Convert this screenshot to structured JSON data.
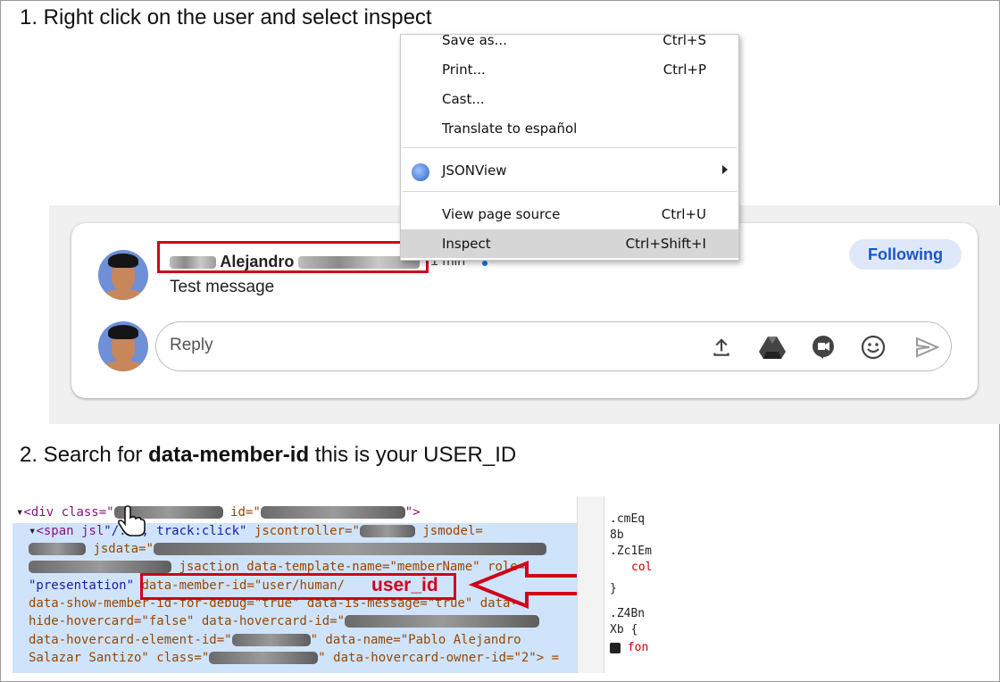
{
  "steps": {
    "step1": "1. Right click on the user and select inspect",
    "step2_prefix": "2. Search for ",
    "step2_bold": "data-member-id",
    "step2_suffix": " this is your USER_ID"
  },
  "context_menu": {
    "items": [
      {
        "label": "Save as...",
        "shortcut": "Ctrl+S"
      },
      {
        "label": "Print...",
        "shortcut": "Ctrl+P"
      },
      {
        "label": "Cast...",
        "shortcut": ""
      },
      {
        "label": "Translate to español",
        "shortcut": ""
      },
      {
        "label": "JSONView",
        "shortcut": ""
      },
      {
        "label": "View page source",
        "shortcut": "Ctrl+U"
      },
      {
        "label": "Inspect",
        "shortcut": "Ctrl+Shift+I"
      }
    ]
  },
  "chat": {
    "sender_name": "Alejandro",
    "time": "1 min",
    "message": "Test message",
    "following_label": "Following",
    "reply_placeholder": "Reply"
  },
  "devtools": {
    "line1_open": "<div class=\"",
    "line1_id": "id=\"",
    "line1_close": "\">",
    "line2_span": "<span jsl",
    "line2_track": "\"/..., track:click\"",
    "line2_jscontroller": "jscontroller=\"",
    "line2_jsmodel": "jsmodel=",
    "line3_jsdata": "jsdata=\"",
    "line4_jsaction": "jsaction data-template-name=\"memberName\" role=",
    "line5_presentation": "\"presentation\"",
    "line5_member": "data-member-id=\"user/human/",
    "user_id_label": "user_id",
    "line6": "data-show-member-id-for-debug=\"true\" data-is-message=\"true\" data-",
    "line7_a": "hide-hovercard=\"false\" data-hovercard-id=\"",
    "line8_a": "data-hovercard-element-id=\"",
    "line8_b": "\" data-name=\"Pablo Alejandro",
    "line9_a": "Salazar Santizo\" class=\"",
    "line9_b": "\" data-hovercard-owner-id=\"2\"> ="
  },
  "devtools_right": {
    "lines": [
      ".cmEq",
      "8b",
      ".Zc1Em",
      "col",
      "}",
      ".Z4Bn",
      "Xb {",
      "fon"
    ]
  },
  "colors": {
    "highlight_red": "#d0021b",
    "following_bg": "#dfe8f8",
    "following_text": "#1a56c8",
    "selection_blue": "#cfe4fb"
  }
}
